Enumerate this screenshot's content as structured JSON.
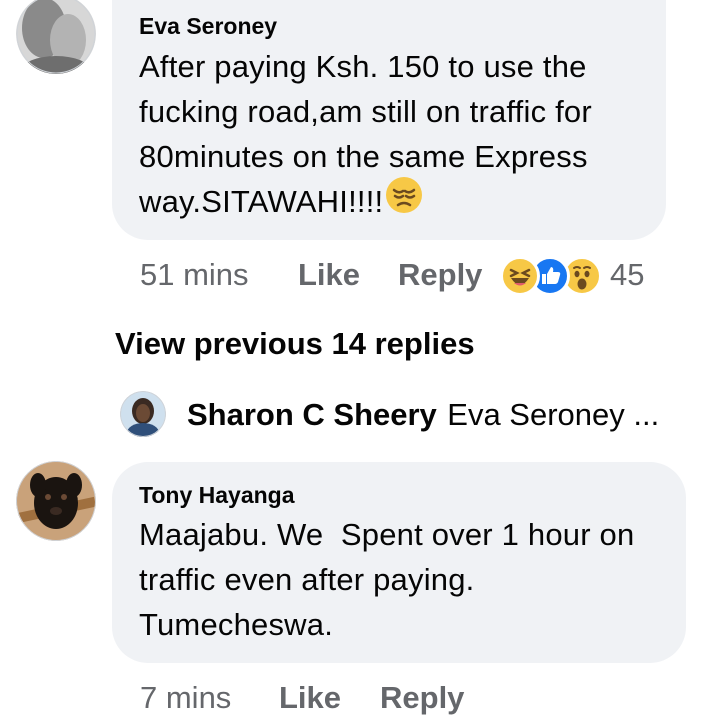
{
  "comments": [
    {
      "author": "Eva Seroney",
      "text_lines": [
        "After paying Ksh. 150 to use the",
        "fucking road,am still on traffic for",
        "80minutes on the same Express",
        "way.SITAWAHI!!!!"
      ],
      "inline_emoji": "pensive-face-icon",
      "time": "51 mins",
      "like_label": "Like",
      "reply_label": "Reply",
      "reaction_icons": [
        "laughing-face-icon",
        "like-thumb-icon",
        "wow-face-icon"
      ],
      "reaction_count": "45"
    },
    {
      "author": "Tony Hayanga",
      "text_lines": [
        "Maajabu. We  Spent over 1 hour on",
        "traffic even after paying.",
        "Tumecheswa."
      ],
      "time": "7 mins",
      "like_label": "Like",
      "reply_label": "Reply"
    }
  ],
  "view_previous": "View previous 14 replies",
  "reply_preview": {
    "author": "Sharon C Sheery",
    "text": "Eva Seroney ..."
  },
  "colors": {
    "bubble": "#f0f2f5",
    "meta_text": "#65676b",
    "like_blue": "#1877f2",
    "emoji_yellow": "#f7c846"
  }
}
